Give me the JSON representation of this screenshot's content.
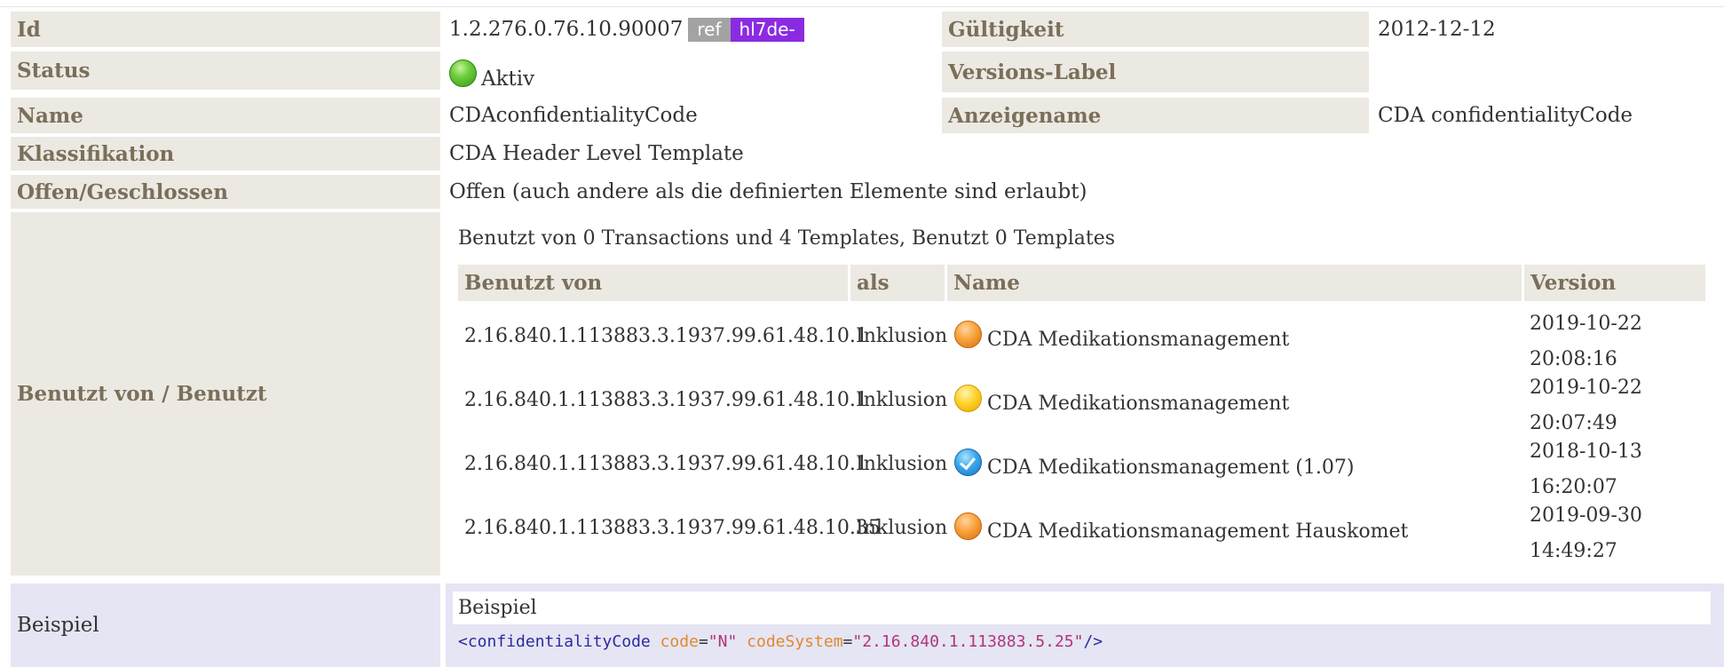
{
  "metadata": {
    "id_label": "Id",
    "id_value": "1.2.276.0.76.10.90007",
    "ref_badge": "ref",
    "prefix_badge": "hl7de-",
    "gueltigkeit_label": "Gültigkeit",
    "gueltigkeit_value": "2012-12-12",
    "status_label": "Status",
    "status_value": "Aktiv",
    "versions_label": "Versions-Label",
    "versions_value": "",
    "name_label": "Name",
    "name_value": "CDAconfidentialityCode",
    "anzeigename_label": "Anzeigename",
    "anzeigename_value": "CDA confidentialityCode",
    "klassifikation_label": "Klassifikation",
    "klassifikation_value": "CDA Header Level Template",
    "offen_label": "Offen/Geschlossen",
    "offen_value": "Offen (auch andere als die definierten Elemente sind erlaubt)",
    "status_color": "#5cbf2a"
  },
  "usage": {
    "label": "Benutzt von / Benutzt",
    "summary": "Benutzt von 0 Transactions und 4 Templates, Benutzt 0 Templates",
    "columns": [
      "Benutzt von",
      "als",
      "Name",
      "Version"
    ],
    "rows": [
      {
        "id": "2.16.840.1.113883.3.1937.99.61.48.10.1",
        "als": "Inklusion",
        "status_icon": "orange-status-icon",
        "name": "CDA Medikationsmanagement",
        "date": "2019-10-22",
        "time": "20:08:16"
      },
      {
        "id": "2.16.840.1.113883.3.1937.99.61.48.10.1",
        "als": "Inklusion",
        "status_icon": "yellow-status-icon",
        "name": "CDA Medikationsmanagement",
        "date": "2019-10-22",
        "time": "20:07:49"
      },
      {
        "id": "2.16.840.1.113883.3.1937.99.61.48.10.1",
        "als": "Inklusion",
        "status_icon": "blue-check-icon",
        "name": "CDA Medikationsmanagement (1.07)",
        "date": "2018-10-13",
        "time": "16:20:07"
      },
      {
        "id": "2.16.840.1.113883.3.1937.99.61.48.10.35",
        "als": "Inklusion",
        "status_icon": "orange-status-icon",
        "name": "CDA Medikationsmanagement Hauskomet",
        "date": "2019-09-30",
        "time": "14:49:27"
      }
    ]
  },
  "example": {
    "label": "Beispiel",
    "title": "Beispiel",
    "code_open": "<confidentialityCode",
    "attr1_name": "code",
    "eq": "=",
    "attr1_value": "\"N\"",
    "attr2_name": "codeSystem",
    "attr2_value": "\"2.16.840.1.113883.5.25\"",
    "code_close": "/>"
  }
}
